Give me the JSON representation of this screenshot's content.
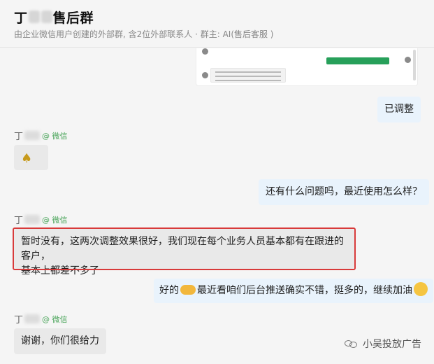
{
  "header": {
    "title_left": "丁",
    "title_right": "售后群",
    "subtitle": "由企业微信用户创建的外部群, 含2位外部联系人 · 群主: AI(售后客服 )"
  },
  "messages": {
    "adjusted": "已调整",
    "sender_name": "丁",
    "sender_app": "@ 微信",
    "ask_usage": "还有什么问题吗，最近使用怎么样？",
    "reply_line1": "暂时没有，这两次调整效果很好，我们现在每个业务人员基本都有在跟进的客户，",
    "reply_line2": "基本上都差不多了",
    "cheer_part1": "好的",
    "cheer_part2": "最近看咱们后台推送确实不错，挺多的，继续加油",
    "thanks": "谢谢，你们很给力"
  },
  "icons": {
    "banana": "banana-emoji-icon",
    "handshake": "handshake-emoji-icon",
    "muscle": "muscle-face-emoji-icon",
    "watermark": "wechat-official-account-icon"
  },
  "watermark": {
    "text": "小吴投放广告"
  },
  "colors": {
    "outgoing_bubble": "#e9f3fc",
    "incoming_bubble": "#e9e9e9",
    "highlight_border": "#d83a3a",
    "wechat_green": "#4ba55b"
  }
}
